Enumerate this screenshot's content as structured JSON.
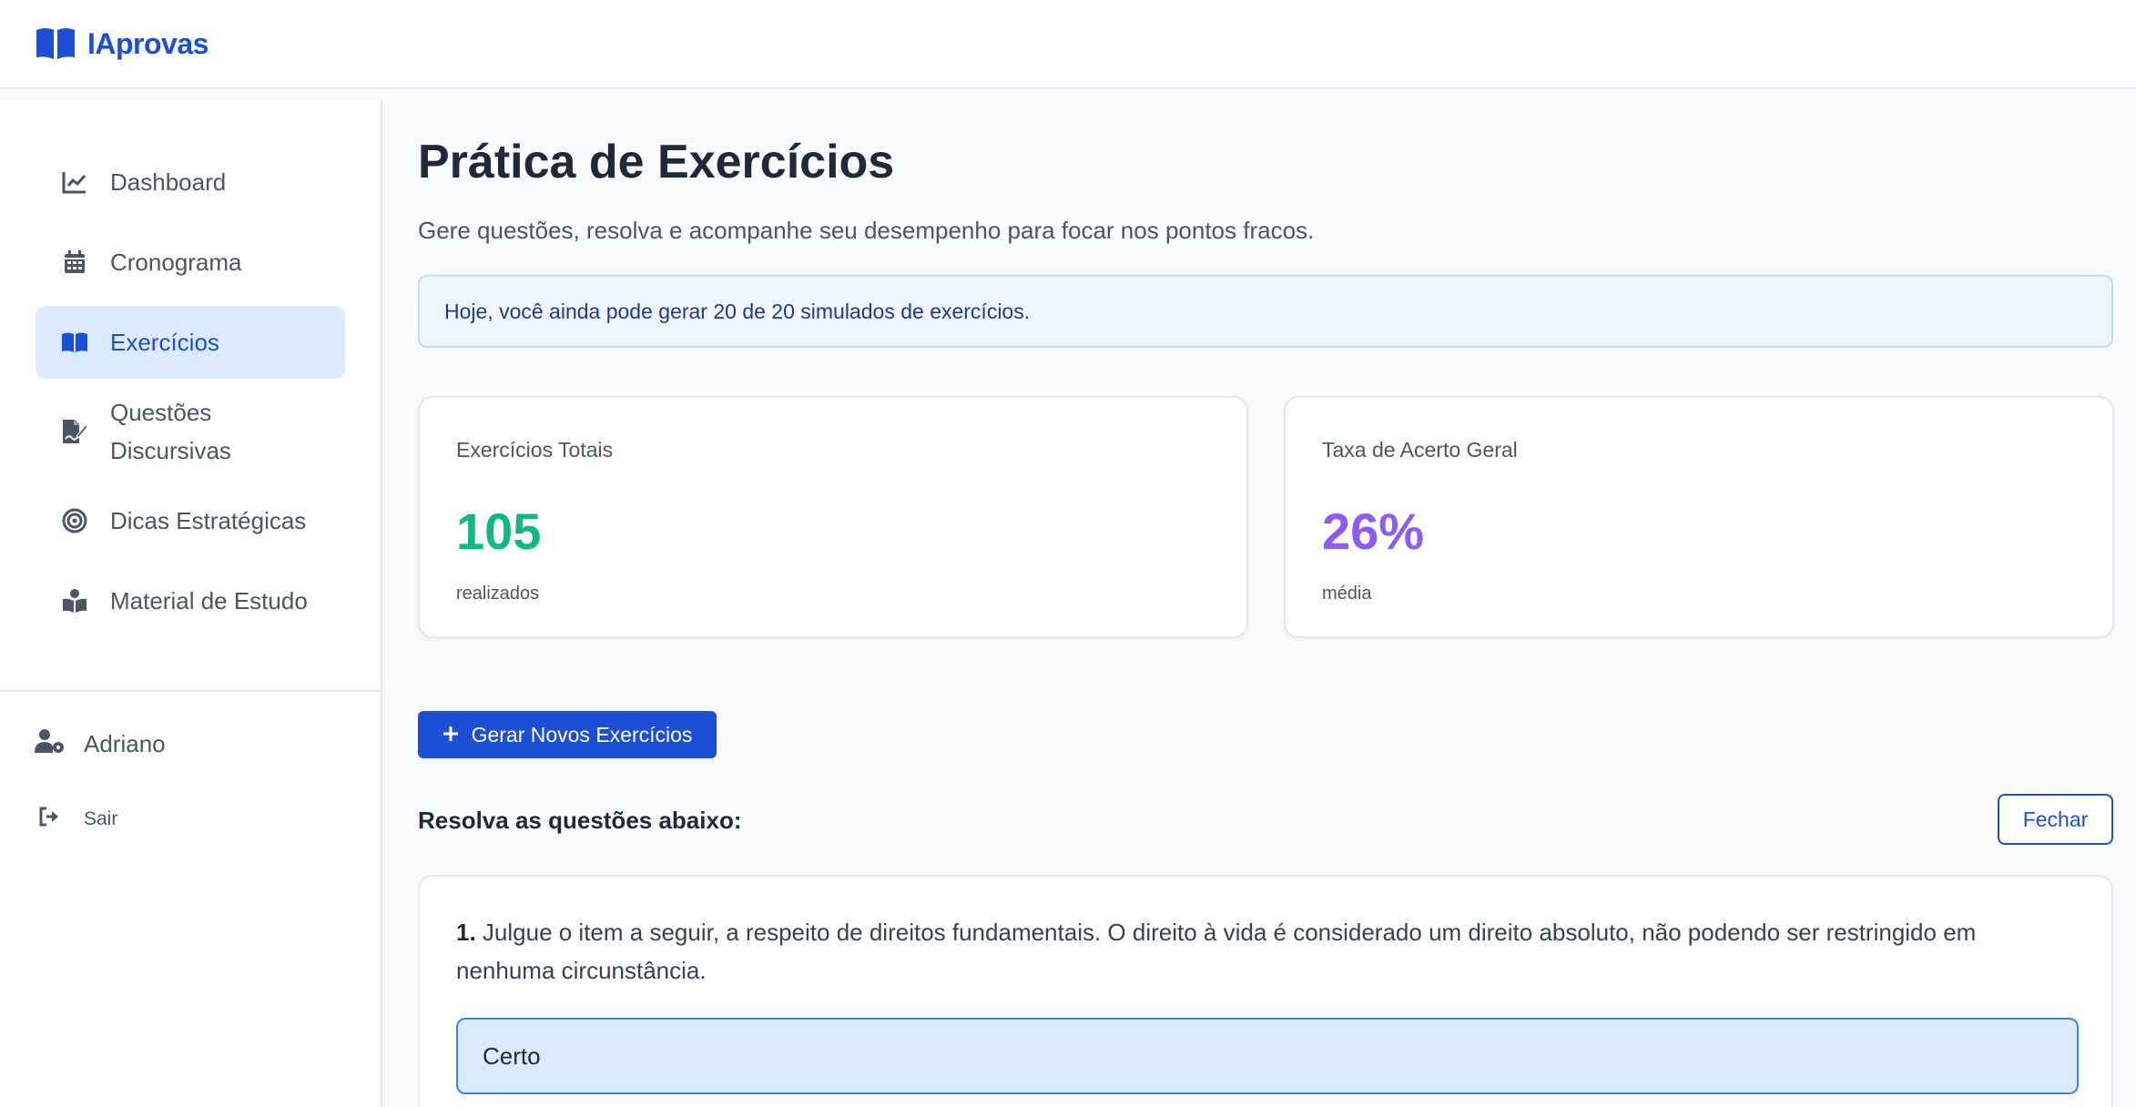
{
  "brand": {
    "name": "IAprovas",
    "icon": "open-book-icon",
    "color": "#1d4ed8"
  },
  "sidebar": {
    "items": [
      {
        "label": "Dashboard",
        "icon": "chart-line-icon",
        "active": false
      },
      {
        "label": "Cronograma",
        "icon": "calendar-icon",
        "active": false
      },
      {
        "label": "Exercícios",
        "icon": "open-book-icon",
        "active": true
      },
      {
        "label": "Questões Discursivas",
        "icon": "file-signature-icon",
        "active": false
      },
      {
        "label": "Dicas Estratégicas",
        "icon": "target-icon",
        "active": false
      },
      {
        "label": "Material de Estudo",
        "icon": "book-reader-icon",
        "active": false
      }
    ],
    "user": {
      "name": "Adriano",
      "icon": "user-cog-icon"
    },
    "logout": {
      "label": "Sair",
      "icon": "sign-out-icon"
    }
  },
  "main": {
    "title": "Prática de Exercícios",
    "subtitle": "Gere questões, resolva e acompanhe seu desempenho para focar nos pontos fracos.",
    "banner": "Hoje, você ainda pode gerar 20 de 20 simulados de exercícios.",
    "stats": [
      {
        "label": "Exercícios Totais",
        "value": "105",
        "caption": "realizados",
        "color": "#10b981"
      },
      {
        "label": "Taxa de Acerto Geral",
        "value": "26%",
        "caption": "média",
        "color": "#8b5cf6"
      }
    ],
    "generate_button": "Gerar Novos Exercícios",
    "section_title": "Resolva as questões abaixo:",
    "close_button": "Fechar",
    "question": {
      "number": "1.",
      "text": " Julgue o item a seguir, a respeito de direitos fundamentais. O direito à vida é considerado um direito absoluto, não podendo ser restringido em nenhuma circunstância.",
      "options": [
        "Certo"
      ]
    }
  }
}
